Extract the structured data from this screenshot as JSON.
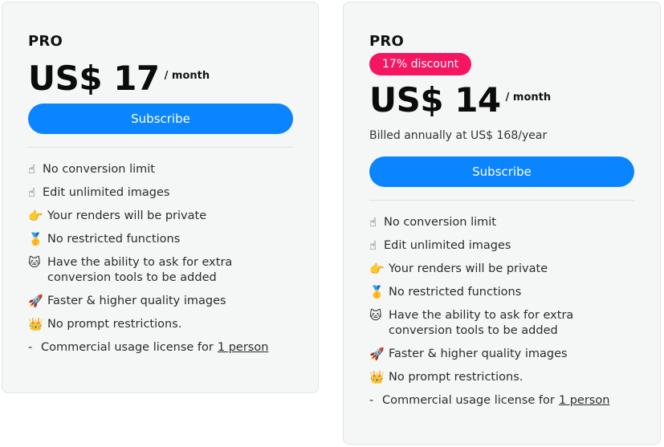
{
  "plans": [
    {
      "name": "PRO",
      "price": "US$ 17",
      "per": "/ month",
      "subscribe_label": "Subscribe",
      "features": [
        {
          "icon": "pointing-finger-up-icon",
          "glyph": "☝",
          "text": "No conversion limit"
        },
        {
          "icon": "pointing-finger-up-icon",
          "glyph": "☝",
          "text": "Edit unlimited images"
        },
        {
          "icon": "pointing-finger-right-icon",
          "glyph": "👉",
          "text": "Your renders will be private"
        },
        {
          "icon": "medal-icon",
          "glyph": "🥇",
          "text": "No restricted functions"
        },
        {
          "icon": "cat-face-icon",
          "glyph": "🐱",
          "text": "Have the ability to ask for extra conversion tools to be added"
        },
        {
          "icon": "rocket-icon",
          "glyph": "🚀",
          "text": "Faster & higher quality images"
        },
        {
          "icon": "crown-icon",
          "glyph": "👑",
          "text": "No prompt restrictions."
        }
      ],
      "license_text": "Commercial usage license for",
      "license_link": "1 person"
    },
    {
      "name": "PRO",
      "discount": "17% discount",
      "price": "US$ 14",
      "per": "/ month",
      "billed": "Billed annually at US$ 168/year",
      "subscribe_label": "Subscribe",
      "features": [
        {
          "icon": "pointing-finger-up-icon",
          "glyph": "☝",
          "text": "No conversion limit"
        },
        {
          "icon": "pointing-finger-up-icon",
          "glyph": "☝",
          "text": "Edit unlimited images"
        },
        {
          "icon": "pointing-finger-right-icon",
          "glyph": "👉",
          "text": "Your renders will be private"
        },
        {
          "icon": "medal-icon",
          "glyph": "🥇",
          "text": "No restricted functions"
        },
        {
          "icon": "cat-face-icon",
          "glyph": "🐱",
          "text": "Have the ability to ask for extra conversion tools to be added"
        },
        {
          "icon": "rocket-icon",
          "glyph": "🚀",
          "text": "Faster & higher quality images"
        },
        {
          "icon": "crown-icon",
          "glyph": "👑",
          "text": "No prompt restrictions."
        }
      ],
      "license_text": "Commercial usage license for",
      "license_link": "1 person"
    }
  ],
  "colors": {
    "accent": "#0a84ff",
    "discount": "#f51662",
    "card_bg": "#f5f7f7"
  }
}
